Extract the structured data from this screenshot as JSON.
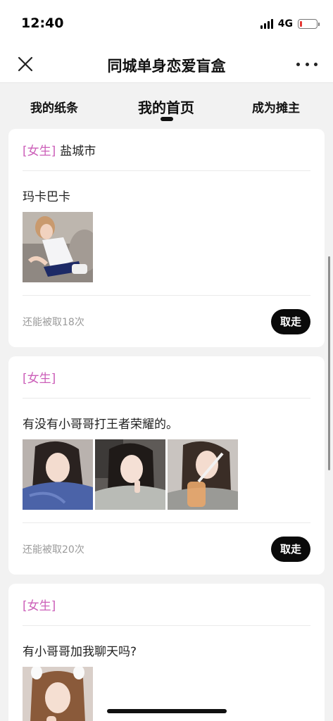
{
  "status_bar": {
    "time": "12:40",
    "network": "4G",
    "signal_icon": "signal-bars-icon",
    "battery_icon": "battery-low-icon",
    "battery_level": 0.15,
    "battery_color": "#e53935"
  },
  "nav": {
    "title": "同城单身恋爱盲盒",
    "close_icon": "close-icon",
    "more_icon": "more-dots-icon"
  },
  "tabs": [
    {
      "label": "我的纸条",
      "active": false
    },
    {
      "label": "我的首页",
      "active": true
    },
    {
      "label": "成为摊主",
      "active": false
    }
  ],
  "colors": {
    "gender_tag": "#cc5fb9",
    "button_bg": "#0a0a0a",
    "page_bg": "#f2f2f2"
  },
  "cards": [
    {
      "gender": "[女生]",
      "city": "盐城市",
      "text": "玛卡巴卡",
      "photo_count": 1,
      "remaining": "还能被取18次",
      "button": "取走"
    },
    {
      "gender": "[女生]",
      "city": "",
      "text": "有没有小哥哥打王者荣耀的。",
      "photo_count": 3,
      "remaining": "还能被取20次",
      "button": "取走"
    },
    {
      "gender": "[女生]",
      "city": "",
      "text": "有小哥哥加我聊天吗?",
      "photo_count": 1
    }
  ]
}
